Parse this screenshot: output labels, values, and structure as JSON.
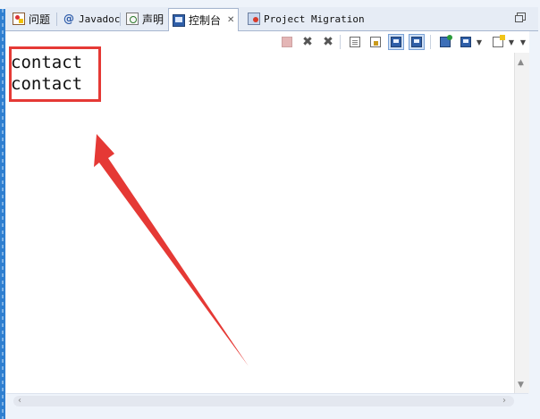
{
  "tabs": [
    {
      "label": "问题",
      "icon": "problems-icon"
    },
    {
      "label": "Javadoc",
      "icon": "at-icon"
    },
    {
      "label": "声明",
      "icon": "declaration-icon"
    },
    {
      "label": "控制台",
      "icon": "console-icon",
      "active": true,
      "close": "✕"
    },
    {
      "label": "Project Migration",
      "icon": "project-migration-icon"
    }
  ],
  "console": {
    "lines": [
      "contact",
      "contact"
    ]
  },
  "colors": {
    "highlight": "#e53935",
    "tab_bar": "#e6ecf5",
    "frame": "#eef3fa"
  }
}
